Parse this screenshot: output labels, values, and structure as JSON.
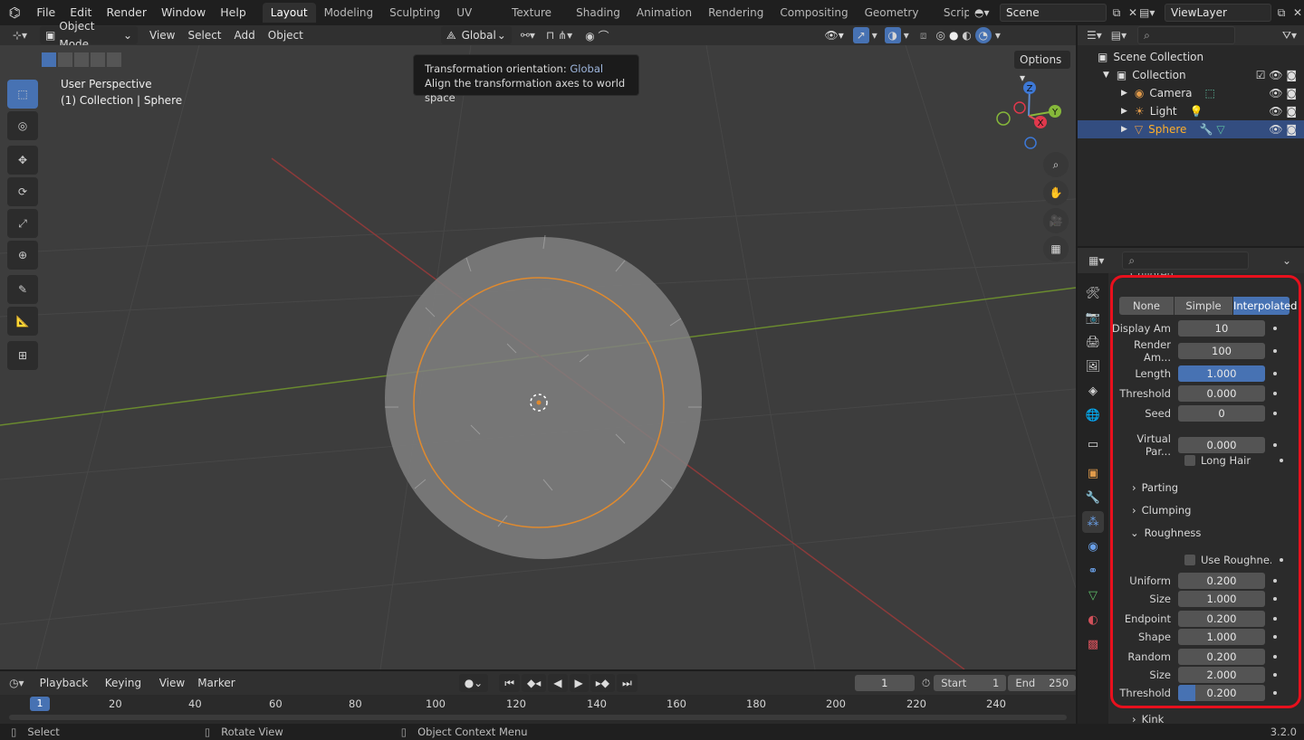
{
  "topbar": {
    "menus": [
      "File",
      "Edit",
      "Render",
      "Window",
      "Help"
    ],
    "workspaces": [
      "Layout",
      "Modeling",
      "Sculpting",
      "UV Editing",
      "Texture Paint",
      "Shading",
      "Animation",
      "Rendering",
      "Compositing",
      "Geometry Nodes",
      "Scripting"
    ],
    "active_workspace": "Layout",
    "scene": "Scene",
    "view_layer": "ViewLayer"
  },
  "viewport_header": {
    "mode": "Object Mode",
    "menus": [
      "View",
      "Select",
      "Add",
      "Object"
    ],
    "orientation": "Global",
    "options": "Options"
  },
  "viewport": {
    "perspective": "User Perspective",
    "collection_info": "(1) Collection | Sphere",
    "tooltip_title": "Transformation orientation:",
    "tooltip_value": "Global",
    "tooltip_desc": "Align the transformation axes to world space",
    "axes": {
      "z": "Z",
      "y": "Y",
      "x": "X"
    }
  },
  "timeline": {
    "menus": [
      "Playback",
      "Keying",
      "View",
      "Marker"
    ],
    "current_frame": "1",
    "start_label": "Start",
    "start": "1",
    "end_label": "End",
    "end": "250",
    "ruler": [
      "1",
      "20",
      "40",
      "60",
      "80",
      "100",
      "120",
      "140",
      "160",
      "180",
      "200",
      "220",
      "240"
    ]
  },
  "status": {
    "select": "Select",
    "rotate": "Rotate View",
    "context": "Object Context Menu",
    "version": "3.2.0"
  },
  "outliner": {
    "root": "Scene Collection",
    "collection": "Collection",
    "items": [
      "Camera",
      "Light",
      "Sphere"
    ],
    "selected": "Sphere"
  },
  "properties": {
    "section_cut": "Children",
    "modes": [
      "None",
      "Simple",
      "Interpolated"
    ],
    "active_mode": "Interpolated",
    "fields1": [
      {
        "label": "Display Am",
        "value": "10"
      },
      {
        "label": "Render Am...",
        "value": "100"
      }
    ],
    "fields2": [
      {
        "label": "Length",
        "value": "1.000",
        "hl": true
      },
      {
        "label": "Threshold",
        "value": "0.000"
      },
      {
        "label": "Seed",
        "value": "0"
      }
    ],
    "virtual": {
      "label": "Virtual Par...",
      "value": "0.000"
    },
    "long_hair": "Long Hair",
    "panels": [
      "Parting",
      "Clumping",
      "Roughness"
    ],
    "use_rough": "Use Roughne...",
    "rough_fields": [
      {
        "label": "Uniform",
        "value": "0.200"
      },
      {
        "label": "Size",
        "value": "1.000"
      },
      {
        "label": "Endpoint",
        "value": "0.200"
      },
      {
        "label": "Shape",
        "value": "1.000"
      },
      {
        "label": "Random",
        "value": "0.200"
      },
      {
        "label": "Size",
        "value": "2.000"
      },
      {
        "label": "Threshold",
        "value": "0.200"
      }
    ],
    "threshold_fill": 0.2,
    "kink": "Kink"
  },
  "colors": {
    "accent": "#4772b3",
    "selection": "#ffaf29",
    "highlight_box": "#e8101d"
  }
}
